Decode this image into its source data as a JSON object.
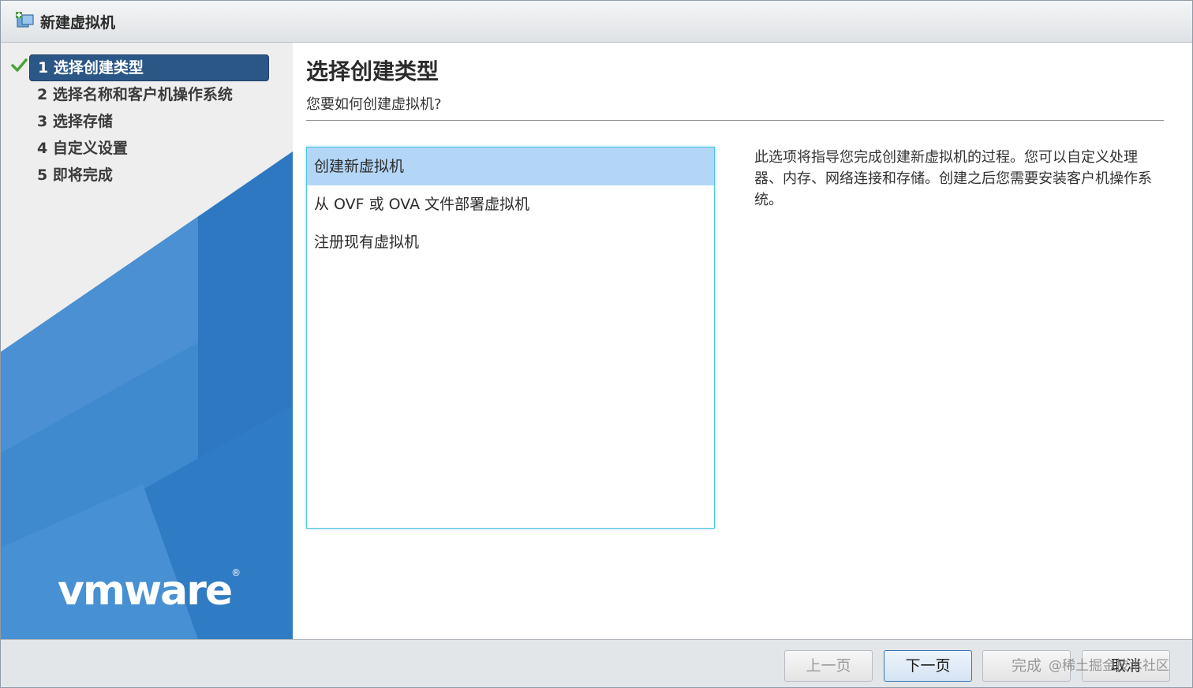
{
  "window": {
    "title": "新建虚拟机",
    "icon": "new-vm-icon"
  },
  "sidebar": {
    "steps": [
      {
        "label": "1 选择创建类型",
        "completed": true,
        "active": true
      },
      {
        "label": "2 选择名称和客户机操作系统",
        "completed": false,
        "active": false
      },
      {
        "label": "3 选择存储",
        "completed": false,
        "active": false
      },
      {
        "label": "4 自定义设置",
        "completed": false,
        "active": false
      },
      {
        "label": "5 即将完成",
        "completed": false,
        "active": false
      }
    ],
    "logo_text": "vmware",
    "logo_mark": "®"
  },
  "main": {
    "title": "选择创建类型",
    "subtitle": "您要如何创建虚拟机?",
    "options": [
      {
        "label": "创建新虚拟机",
        "selected": true
      },
      {
        "label": "从 OVF 或 OVA 文件部署虚拟机",
        "selected": false
      },
      {
        "label": "注册现有虚拟机",
        "selected": false
      }
    ],
    "description": "此选项将指导您完成创建新虚拟机的过程。您可以自定义处理器、内存、网络连接和存储。创建之后您需要安装客户机操作系统。"
  },
  "footer": {
    "back_label": "上一页",
    "next_label": "下一页",
    "finish_label": "完成",
    "cancel_label": "取消"
  },
  "watermark": "@稀土掘金技术社区",
  "colors": {
    "active_step_bg": "#2b5787",
    "selected_option_bg": "#b3d6f7",
    "list_border": "#4cc3e6",
    "sidebar_blue": "#2f7bc4",
    "check_green": "#4aa33a"
  }
}
